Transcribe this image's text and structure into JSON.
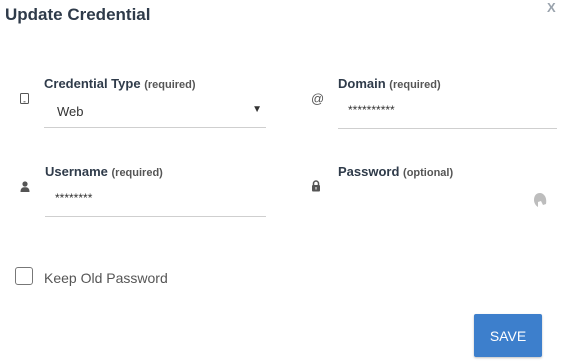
{
  "dialog": {
    "title": "Update Credential",
    "close_label": "X"
  },
  "fields": {
    "credential_type": {
      "label": "Credential Type",
      "req": "(required)",
      "value": "Web",
      "icon": "tablet-icon"
    },
    "domain": {
      "label": "Domain",
      "req": "(required)",
      "value": "**********",
      "icon": "at-icon",
      "icon_glyph": "@"
    },
    "username": {
      "label": "Username",
      "req": "(required)",
      "value": "********",
      "icon": "user-icon"
    },
    "password": {
      "label": "Password",
      "req": "(optional)",
      "value": "",
      "icon": "lock-icon"
    }
  },
  "keep_old_password": {
    "label": "Keep Old Password",
    "checked": false
  },
  "save_label": "SAVE",
  "colors": {
    "accent": "#3d7fcc",
    "title": "#2f3b4a"
  }
}
